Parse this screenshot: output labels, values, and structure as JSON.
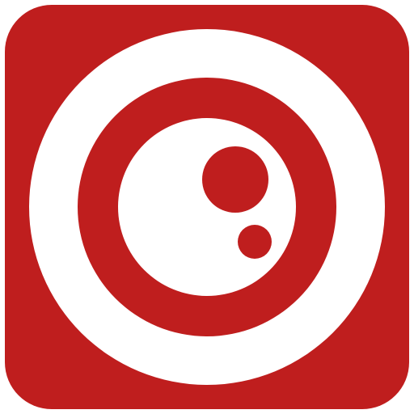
{
  "icon": {
    "name": "camera-lens-app-icon",
    "colors": {
      "background": "#bf1e1e",
      "foreground": "#ffffff"
    }
  }
}
